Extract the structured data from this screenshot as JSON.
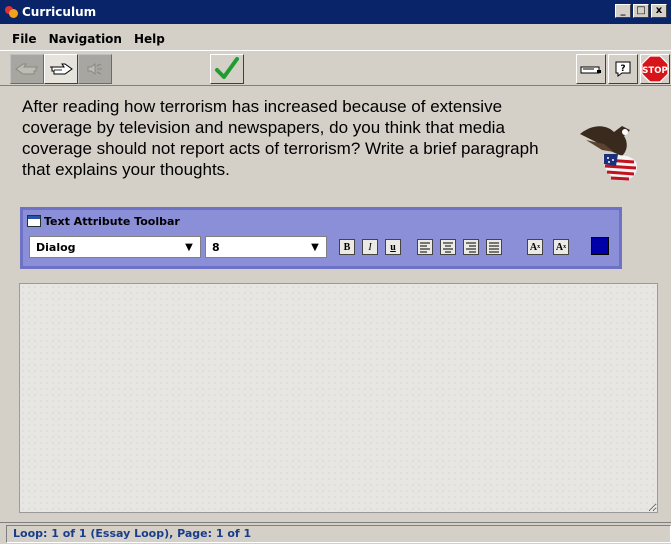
{
  "window": {
    "title": "Curriculum",
    "controls": {
      "minimize": "_",
      "maximize": "□",
      "close": "x"
    }
  },
  "menu": {
    "items": [
      "File",
      "Navigation",
      "Help"
    ]
  },
  "toolbar": {
    "left_buttons": [
      {
        "icon": "back-hand-icon",
        "enabled": false
      },
      {
        "icon": "forward-hand-icon",
        "enabled": true
      },
      {
        "icon": "speaker-icon",
        "enabled": false
      }
    ],
    "check_icon": "checkmark-icon",
    "right_buttons": [
      {
        "icon": "printer-icon"
      },
      {
        "icon": "help-icon",
        "label": "?"
      },
      {
        "icon": "stop-icon",
        "label": "STOP"
      }
    ]
  },
  "question": {
    "text": "After reading how terrorism has increased because of extensive coverage by television and newspapers, do you think that media coverage should not report acts of terrorism? Write a brief paragraph that explains your thoughts."
  },
  "text_attribute_toolbar": {
    "title": "Text Attribute Toolbar",
    "font_family": "Dialog",
    "font_size": "8",
    "format_buttons": [
      {
        "name": "bold-button",
        "label": "B"
      },
      {
        "name": "italic-button",
        "label": "I"
      },
      {
        "name": "underline-button",
        "label": "u"
      }
    ],
    "align_buttons": [
      {
        "name": "align-left-button"
      },
      {
        "name": "align-center-button"
      },
      {
        "name": "align-right-button"
      },
      {
        "name": "align-justify-button"
      }
    ],
    "script_buttons": [
      {
        "name": "superscript-button",
        "label": "A"
      },
      {
        "name": "subscript-button",
        "label": "A"
      }
    ],
    "text_color": "#0000a8"
  },
  "essay": {
    "value": ""
  },
  "status": {
    "text": "Loop: 1 of 1 (Essay Loop),  Page: 1 of 1"
  }
}
